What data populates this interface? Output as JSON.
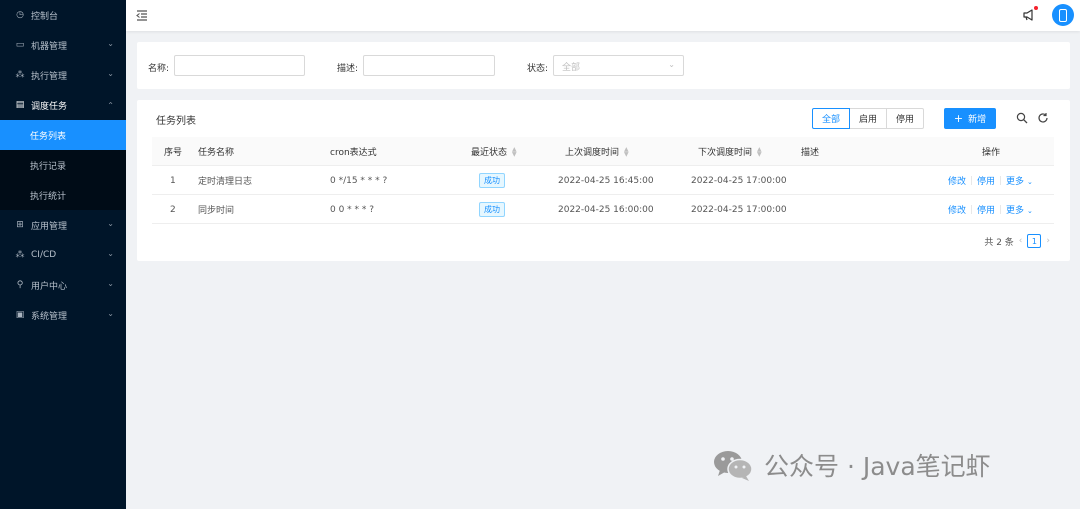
{
  "sidebar": {
    "items": [
      {
        "label": "控制台",
        "icon": "dashboard-icon",
        "glyph": "◷",
        "has_children": false
      },
      {
        "label": "机器管理",
        "icon": "monitor-icon",
        "glyph": "▭",
        "has_children": true
      },
      {
        "label": "执行管理",
        "icon": "cluster-icon",
        "glyph": "⁂",
        "has_children": true
      },
      {
        "label": "调度任务",
        "icon": "schedule-icon",
        "glyph": "▤",
        "has_children": true,
        "open": true,
        "children": [
          "任务列表",
          "执行记录",
          "执行统计"
        ],
        "active_child": 0
      },
      {
        "label": "应用管理",
        "icon": "apps-icon",
        "glyph": "⊞",
        "has_children": true
      },
      {
        "label": "CI/CD",
        "icon": "pipeline-icon",
        "glyph": "⁂",
        "has_children": true
      },
      {
        "label": "用户中心",
        "icon": "user-icon",
        "glyph": "⚲",
        "has_children": true
      },
      {
        "label": "系统管理",
        "icon": "system-icon",
        "glyph": "▣",
        "has_children": true
      }
    ]
  },
  "search": {
    "name_label": "名称:",
    "name_value": "",
    "desc_label": "描述:",
    "desc_value": "",
    "status_label": "状态:",
    "status_placeholder": "全部"
  },
  "list": {
    "title": "任务列表",
    "filters": [
      "全部",
      "启用",
      "停用"
    ],
    "active_filter": 0,
    "add_label": "新增",
    "columns": [
      "序号",
      "任务名称",
      "cron表达式",
      "最近状态",
      "上次调度时间",
      "下次调度时间",
      "描述",
      "操作"
    ],
    "rows": [
      {
        "index": "1",
        "name": "定时清理日志",
        "cron": "0 */15 * * * ?",
        "status": "成功",
        "last_run": "2022-04-25 16:45:00",
        "next_run": "2022-04-25 17:00:00",
        "desc": ""
      },
      {
        "index": "2",
        "name": "同步时间",
        "cron": "0 0 * * * ?",
        "status": "成功",
        "last_run": "2022-04-25 16:00:00",
        "next_run": "2022-04-25 17:00:00",
        "desc": ""
      }
    ],
    "actions": {
      "edit": "修改",
      "disable": "停用",
      "more": "更多"
    },
    "pagination": {
      "total": "共 2 条",
      "current_page": "1"
    }
  },
  "watermark": "公众号 · Java笔记虾",
  "colors": {
    "primary": "#1890ff",
    "sidebar_bg": "#001529",
    "submenu_bg": "#000c17",
    "danger": "#f5222d"
  }
}
